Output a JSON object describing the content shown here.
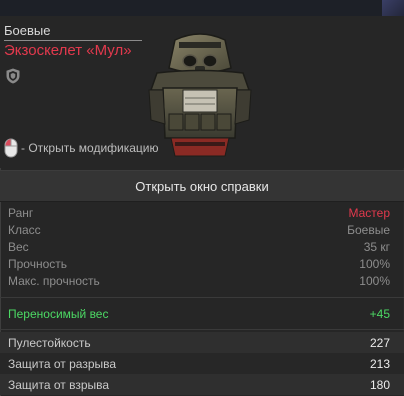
{
  "header": {
    "category": "Боевые",
    "item_name": "Экзоскелет «Мул»",
    "hint_text": "- Открыть модификацию",
    "icons": [
      "shield-icon",
      "mouse-icon"
    ]
  },
  "help_button": {
    "label": "Открыть окно справки"
  },
  "stats": [
    {
      "label": "Ранг",
      "value": "Мастер"
    },
    {
      "label": "Класс",
      "value": "Боевые"
    },
    {
      "label": "Вес",
      "value": "35 кг"
    },
    {
      "label": "Прочность",
      "value": "100%"
    },
    {
      "label": "Макс. прочность",
      "value": "100%"
    }
  ],
  "bonus": {
    "label": "Переносимый вес",
    "value": "+45"
  },
  "protection": [
    {
      "label": "Пулестойкость",
      "value": "227"
    },
    {
      "label": "Защита от разрыва",
      "value": "213"
    },
    {
      "label": "Защита от взрыва",
      "value": "180"
    }
  ],
  "colors": {
    "rank": "#e2394d",
    "item_name": "#e2394d",
    "bonus": "#4cd964"
  }
}
